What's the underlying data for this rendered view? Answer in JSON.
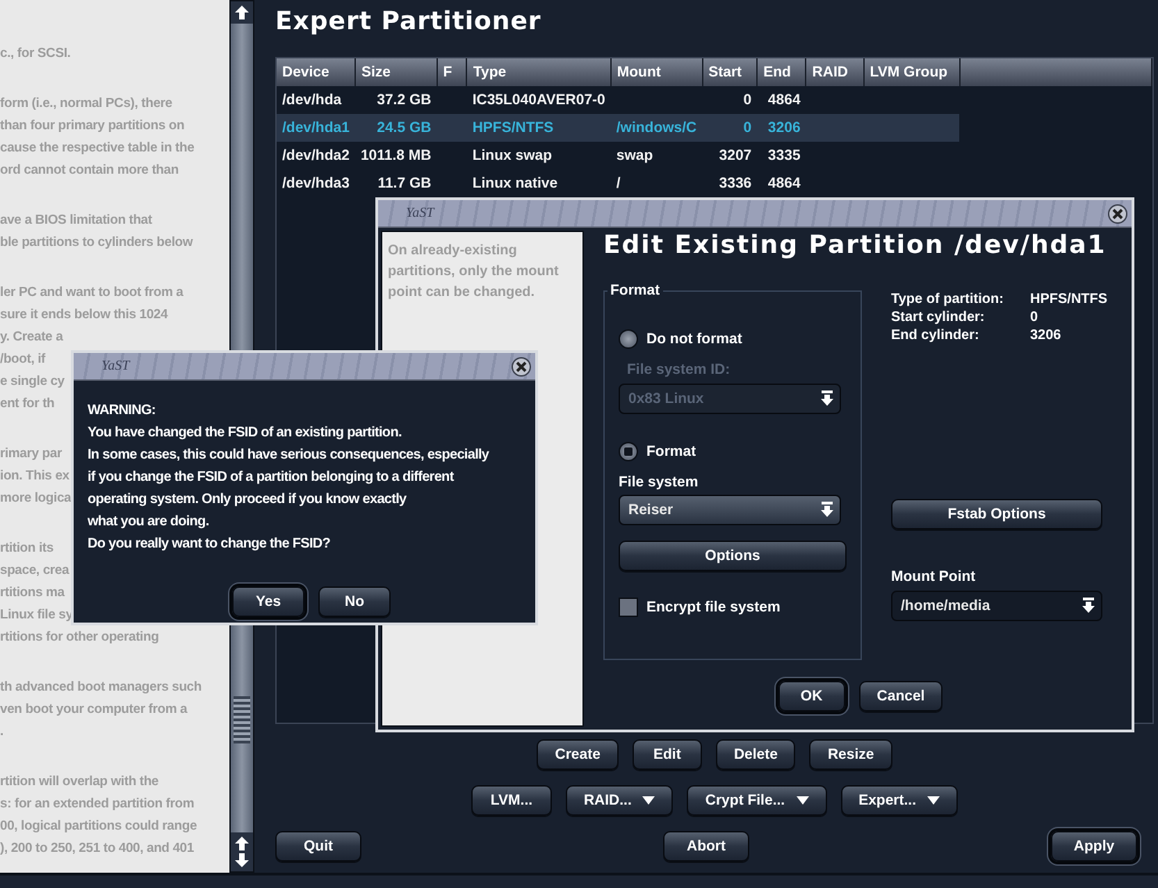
{
  "help_panel": {
    "paragraphs": [
      [
        "c., for SCSI."
      ],
      [
        "form (i.e., normal PCs), there",
        "than four primary partitions on",
        "cause the respective table in the",
        "ord cannot contain more than"
      ],
      [
        "ave a BIOS limitation that",
        "ble partitions to cylinders below"
      ],
      [
        "ler PC and want to boot from a",
        "sure it ends below this 1024",
        "y. Create a",
        "/boot, if",
        "e single cy",
        "ent for th"
      ],
      [
        "rimary par",
        "ion. This ex",
        "more logica"
      ],
      [
        "rtition its",
        "space, crea",
        "rtitions ma",
        "Linux file sy",
        "rtitions for other operating"
      ],
      [
        "th advanced boot managers such",
        "ven boot your computer from a",
        "."
      ],
      [
        "rtition will overlap with the",
        "s: for an extended partition from",
        "00, logical partitions could range",
        "), 200 to 250, 251 to 400, and 401"
      ]
    ]
  },
  "main": {
    "title": "Expert Partitioner",
    "table": {
      "columns": [
        "Device",
        "Size",
        "F",
        "Type",
        "Mount",
        "Start",
        "End",
        "RAID",
        "LVM Group"
      ],
      "rows": [
        {
          "cells": [
            "/dev/hda",
            "37.2 GB",
            "",
            "IC35L040AVER07-0",
            "",
            "0",
            "4864",
            "",
            ""
          ],
          "selected": false
        },
        {
          "cells": [
            "/dev/hda1",
            "24.5 GB",
            "",
            "HPFS/NTFS",
            "/windows/C",
            "0",
            "3206",
            "",
            ""
          ],
          "selected": true
        },
        {
          "cells": [
            "/dev/hda2",
            "1011.8 MB",
            "",
            "Linux swap",
            "swap",
            "3207",
            "3335",
            "",
            ""
          ],
          "selected": false
        },
        {
          "cells": [
            "/dev/hda3",
            "11.7 GB",
            "",
            "Linux native",
            "/",
            "3336",
            "4864",
            "",
            ""
          ],
          "selected": false
        }
      ]
    },
    "button_rows": [
      [
        {
          "label": "Create",
          "has_menu": false
        },
        {
          "label": "Edit",
          "has_menu": false
        },
        {
          "label": "Delete",
          "has_menu": false
        },
        {
          "label": "Resize",
          "has_menu": false
        }
      ],
      [
        {
          "label": "LVM...",
          "has_menu": false
        },
        {
          "label": "RAID...",
          "has_menu": true
        },
        {
          "label": "Crypt File...",
          "has_menu": true
        },
        {
          "label": "Expert...",
          "has_menu": true
        }
      ]
    ],
    "footer_buttons": [
      {
        "label": "Quit",
        "default": false
      },
      {
        "label": "Abort",
        "default": false
      },
      {
        "label": "Apply",
        "default": true
      }
    ]
  },
  "edit_dialog": {
    "window_title": "YaST",
    "help": "On already-existing partitions, only the mount point can be changed.",
    "title": "Edit Existing Partition /dev/hda1",
    "format_group": {
      "title": "Format",
      "options": [
        {
          "label": "Do not format",
          "selected": false
        },
        {
          "label": "Format",
          "selected": true
        }
      ],
      "file_system_id": {
        "label": "File system ID:",
        "value": "0x83 Linux",
        "disabled": true
      },
      "file_system": {
        "label": "File system",
        "value": "Reiser",
        "disabled": false
      },
      "options_button": "Options",
      "encrypt": {
        "label": "Encrypt file system",
        "checked": false
      }
    },
    "info": [
      {
        "label": "Type of partition:",
        "value": "HPFS/NTFS"
      },
      {
        "label": "Start cylinder:",
        "value": "0"
      },
      {
        "label": "End cylinder:",
        "value": "3206"
      }
    ],
    "fstab_button": "Fstab Options",
    "mount_point": {
      "label": "Mount Point",
      "value": "/home/media"
    },
    "buttons": [
      {
        "label": "OK",
        "default": true
      },
      {
        "label": "Cancel",
        "default": false
      }
    ]
  },
  "warning_dialog": {
    "window_title": "YaST",
    "heading": "WARNING:",
    "message_lines": [
      "You have changed the FSID of an existing partition.",
      "In some cases, this could have serious consequences, especially",
      "if you change the FSID of a partition belonging to a different",
      "operating system. Only proceed if you know exactly",
      "what you are doing.",
      "Do you really want to change the FSID?"
    ],
    "buttons": [
      {
        "label": "Yes",
        "default": true
      },
      {
        "label": "No",
        "default": false
      }
    ]
  }
}
